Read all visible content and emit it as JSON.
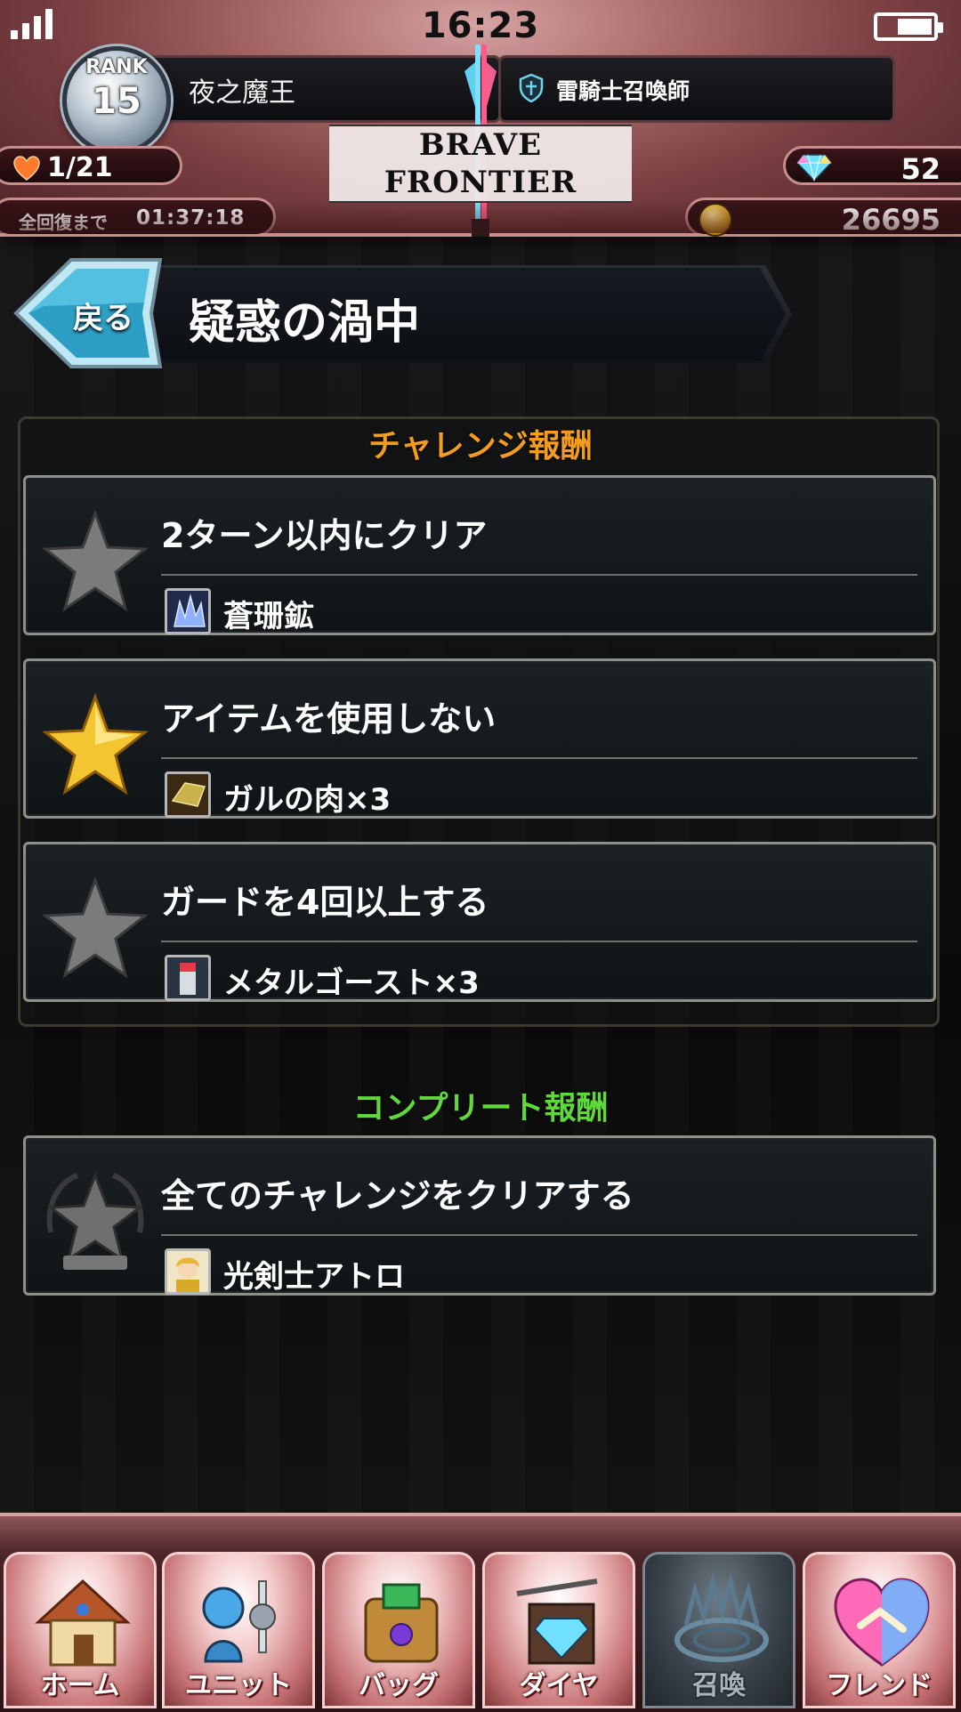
{
  "status_bar": {
    "time": "16:23"
  },
  "header": {
    "rank_label": "RANK",
    "rank_value": "15",
    "player_name": "夜之魔王",
    "player_title": "雷騎士召喚師",
    "logo_text": "BRAVE FRONTIER",
    "energy": "1/21",
    "recovery_label": "全回復まで",
    "recovery_time": "01:37:18",
    "gems": "52",
    "zel": "26695"
  },
  "quest": {
    "back_label": "戻る",
    "title": "疑惑の渦中"
  },
  "challenge": {
    "heading": "チャレンジ報酬",
    "items": [
      {
        "condition": "2ターン以内にクリア",
        "reward": "蒼珊鉱",
        "achieved": false,
        "reward_icon": "crystal-ore-icon"
      },
      {
        "condition": "アイテムを使用しない",
        "reward": "ガルの肉×3",
        "achieved": true,
        "reward_icon": "meat-icon"
      },
      {
        "condition": "ガードを4回以上する",
        "reward": "メタルゴースト×3",
        "achieved": false,
        "reward_icon": "metal-ghost-icon"
      }
    ]
  },
  "complete": {
    "heading": "コンプリート報酬",
    "condition": "全てのチャレンジをクリアする",
    "reward": "光剣士アトロ",
    "reward_icon": "unit-portrait-icon"
  },
  "nav": [
    {
      "label": "ホーム",
      "icon": "home-icon",
      "active": false
    },
    {
      "label": "ユニット",
      "icon": "unit-icon",
      "active": false
    },
    {
      "label": "バッグ",
      "icon": "bag-icon",
      "active": false
    },
    {
      "label": "ダイヤ",
      "icon": "diamond-shop-icon",
      "active": false
    },
    {
      "label": "召喚",
      "icon": "summon-icon",
      "active": true
    },
    {
      "label": "フレンド",
      "icon": "friend-icon",
      "active": false
    }
  ],
  "colors": {
    "challenge_heading": "#f39c1f",
    "complete_heading": "#5ed83a",
    "gold_star": "#f2c531",
    "grey_star": "#7b7b7b"
  }
}
